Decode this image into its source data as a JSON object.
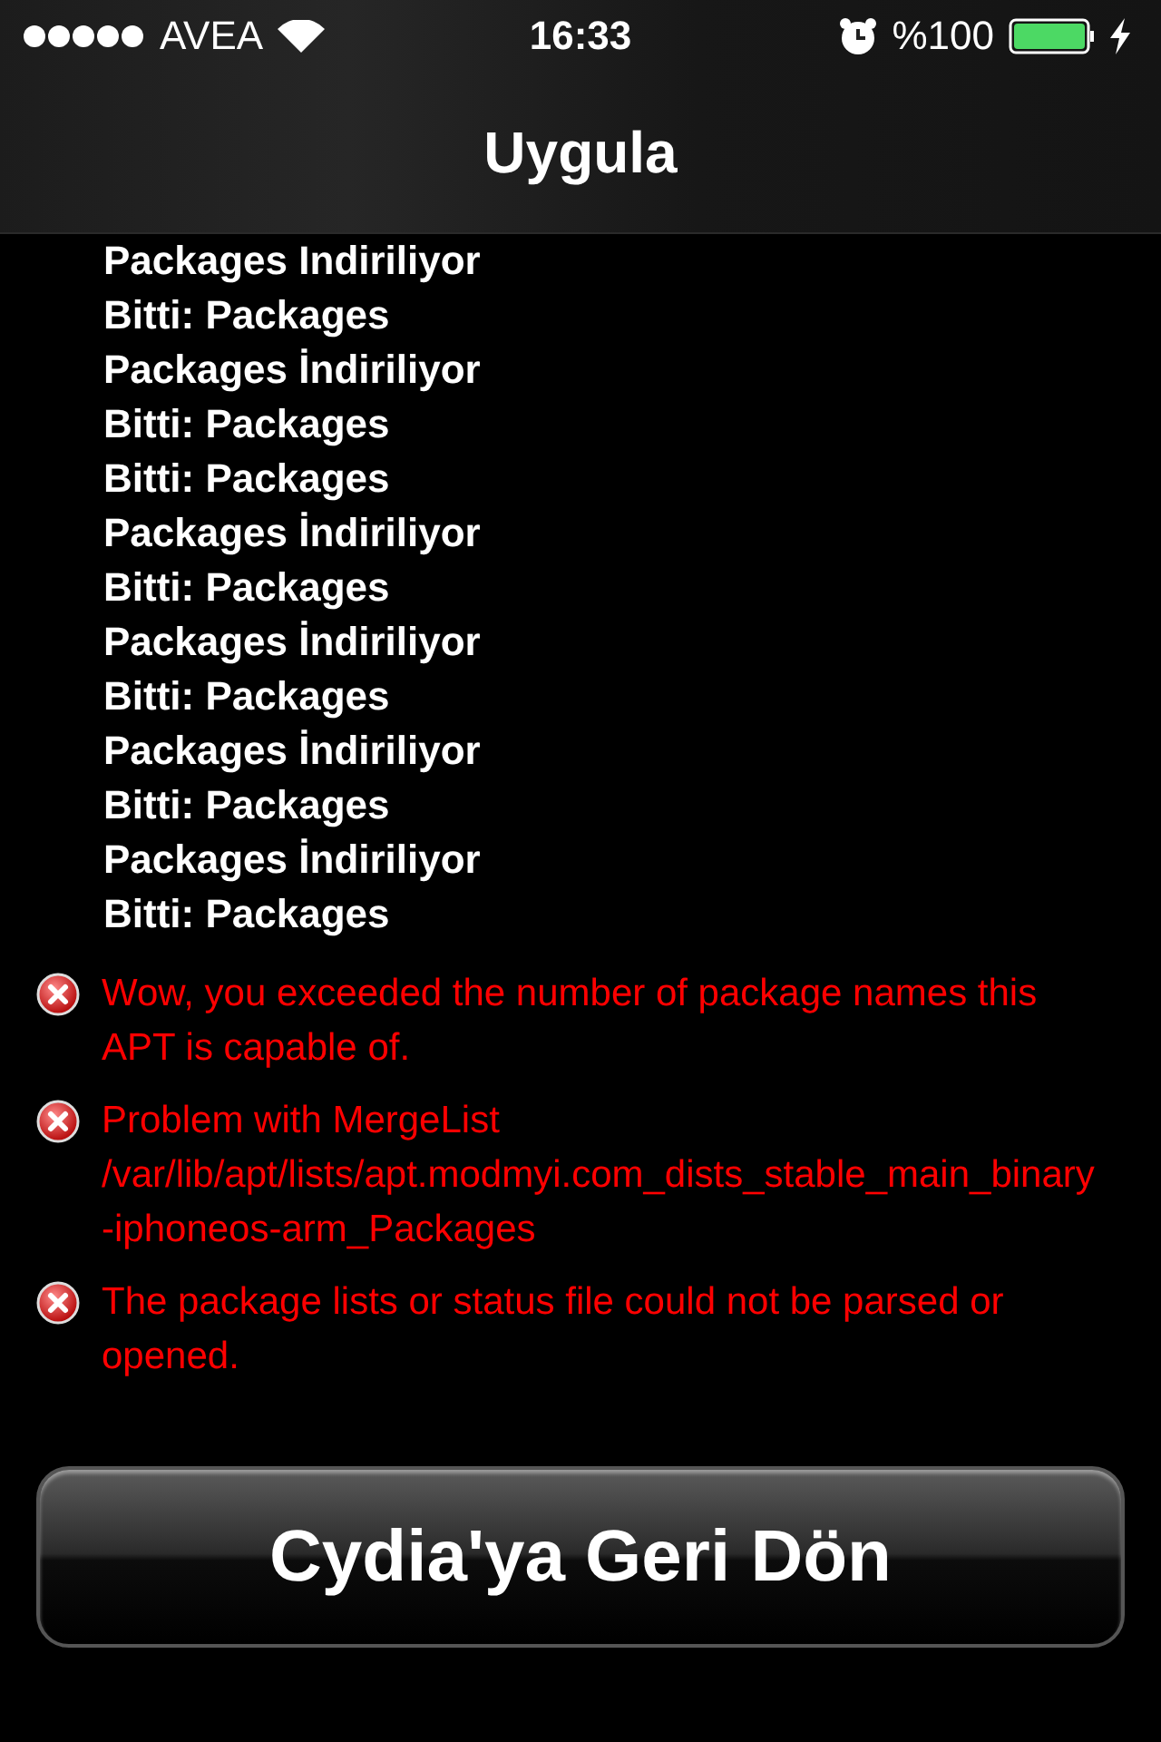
{
  "status_bar": {
    "carrier": "AVEA",
    "time": "16:33",
    "battery": "%100"
  },
  "nav_bar": {
    "title": "Uygula"
  },
  "log": [
    "Packages Indiriliyor",
    "Bitti: Packages",
    "Packages İndiriliyor",
    "Bitti: Packages",
    "Bitti: Packages",
    "Packages İndiriliyor",
    "Bitti: Packages",
    "Packages İndiriliyor",
    "Bitti: Packages",
    "Packages İndiriliyor",
    "Bitti: Packages",
    "Packages İndiriliyor",
    "Bitti: Packages"
  ],
  "errors": [
    "Wow, you exceeded the number of package names this APT is capable of.",
    "Problem with MergeList /var/lib/apt/lists/apt.modmyi.com_dists_stable_main_binary-iphoneos-arm_Packages",
    "The package lists or status file could not be parsed or opened."
  ],
  "button": {
    "label": "Cydia'ya Geri Dön"
  }
}
